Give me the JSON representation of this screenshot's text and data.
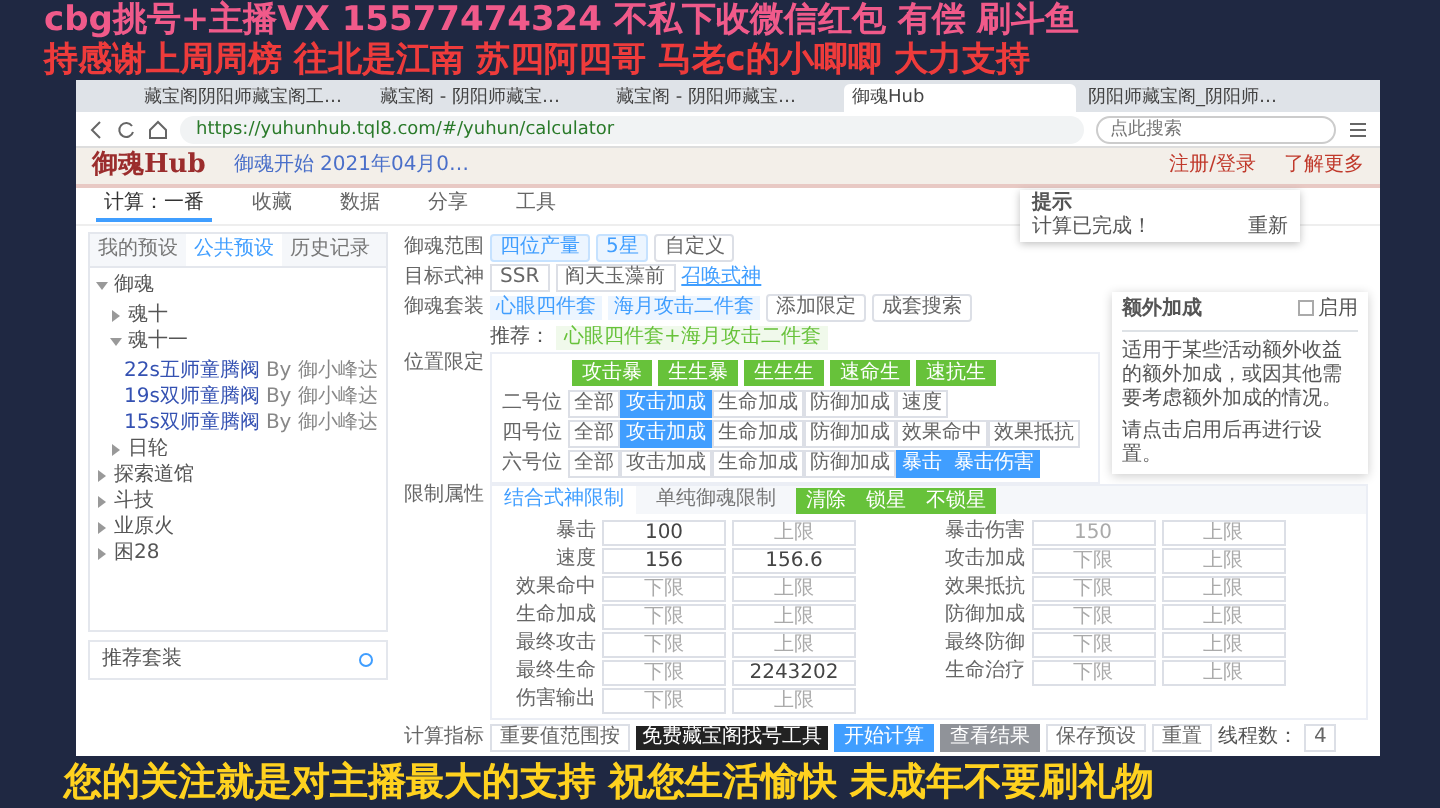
{
  "overlay": {
    "top_lines": [
      "cbg挑号+主播VX 15577474324 不私下收微信红包 有偿 刷斗鱼",
      "持感谢上周周榜  往北是江南 苏四阿四哥 马老c的小唧唧 大力支持"
    ],
    "bottom_line": "您的关注就是对主播最大的支持 祝您生活愉快 未成年不要刷礼物"
  },
  "browser": {
    "tabs": [
      {
        "title": "藏宝阁阴阳师藏宝阁工…",
        "selected": false
      },
      {
        "title": "藏宝阁 - 阴阳师藏宝…",
        "selected": false
      },
      {
        "title": "藏宝阁 - 阴阳师藏宝…",
        "selected": false
      },
      {
        "title": "御魂Hub",
        "selected": true
      },
      {
        "title": "阴阳师藏宝阁_阴阳师…",
        "selected": false
      }
    ],
    "url": "https://yuhunhub.tql8.com/#/yuhun/calculator",
    "search_placeholder": "点此搜索"
  },
  "header": {
    "logo": "御魂Hub",
    "notice": "御魂开始 2021年04月0…",
    "links": [
      "注册/登录",
      "了解更多"
    ]
  },
  "nav": [
    {
      "label": "计算：一番",
      "selected": true
    },
    {
      "label": "收藏",
      "selected": false
    },
    {
      "label": "数据",
      "selected": false
    },
    {
      "label": "分享",
      "selected": false
    },
    {
      "label": "工具",
      "selected": false
    }
  ],
  "sidebar": {
    "tabs": [
      {
        "label": "我的预设",
        "selected": false
      },
      {
        "label": "公共预设",
        "selected": true
      },
      {
        "label": "历史记录",
        "selected": false
      }
    ],
    "tree": [
      {
        "label": "御魂",
        "expanded": true,
        "children": [
          {
            "label": "魂十",
            "expanded": false
          },
          {
            "label": "魂十一",
            "expanded": true,
            "children": [
              {
                "label": "22s五师童腾阀",
                "author": "By 御小峰达"
              },
              {
                "label": "19s双师童腾阀",
                "author": "By 御小峰达"
              },
              {
                "label": "15s双师童腾阀",
                "author": "By 御小峰达"
              }
            ]
          },
          {
            "label": "日轮",
            "expanded": false
          }
        ]
      },
      {
        "label": "探索道馆",
        "expanded": false
      },
      {
        "label": "斗技",
        "expanded": false
      },
      {
        "label": "业原火",
        "expanded": false
      },
      {
        "label": "困28",
        "expanded": false
      }
    ],
    "panel_title": "推荐套装"
  },
  "form": {
    "range": {
      "label": "御魂范围",
      "options": [
        {
          "label": "四位产量",
          "selected": true
        },
        {
          "label": "5星",
          "selected": true
        },
        {
          "label": "自定义",
          "selected": false
        }
      ]
    },
    "target": {
      "label": "目标式神",
      "rarity": "SSR",
      "shikigami": "阎天玉藻前",
      "link": "召唤式神"
    },
    "set": {
      "label": "御魂套装",
      "tags": [
        "心眼四件套",
        "海月攻击二件套"
      ],
      "buttons": [
        "添加限定",
        "成套搜索"
      ],
      "hint_label": "推荐：",
      "hint": "心眼四件套+海月攻击二件套"
    },
    "position": {
      "label": "位置限定",
      "presets": [
        "攻击暴",
        "生生暴",
        "生生生",
        "速命生",
        "速抗生"
      ],
      "rows": [
        {
          "label": "二号位",
          "options": [
            {
              "label": "全部",
              "selected": false
            },
            {
              "label": "攻击加成",
              "selected": true
            },
            {
              "label": "生命加成",
              "selected": false
            },
            {
              "label": "防御加成",
              "selected": false
            },
            {
              "label": "速度",
              "selected": false
            }
          ]
        },
        {
          "label": "四号位",
          "options": [
            {
              "label": "全部",
              "selected": false
            },
            {
              "label": "攻击加成",
              "selected": true
            },
            {
              "label": "生命加成",
              "selected": false
            },
            {
              "label": "防御加成",
              "selected": false
            },
            {
              "label": "效果命中",
              "selected": false
            },
            {
              "label": "效果抵抗",
              "selected": false
            }
          ]
        },
        {
          "label": "六号位",
          "options": [
            {
              "label": "全部",
              "selected": false
            },
            {
              "label": "攻击加成",
              "selected": false
            },
            {
              "label": "生命加成",
              "selected": false
            },
            {
              "label": "防御加成",
              "selected": false
            },
            {
              "label": "暴击",
              "selected": true
            },
            {
              "label": "暴击伤害",
              "selected": true
            }
          ]
        }
      ]
    },
    "limits": {
      "label": "限制属性",
      "tabs": [
        {
          "label": "结合式神限制",
          "selected": true
        },
        {
          "label": "单纯御魂限制",
          "selected": false
        }
      ],
      "buttons": [
        "清除",
        "锁星",
        "不锁星"
      ],
      "left": [
        {
          "label": "暴击",
          "min": {
            "value": "100"
          },
          "max": {
            "placeholder": "上限"
          }
        },
        {
          "label": "速度",
          "min": {
            "value": "156"
          },
          "max": {
            "value": "156.6"
          }
        },
        {
          "label": "效果命中",
          "min": {
            "placeholder": "下限"
          },
          "max": {
            "placeholder": "上限"
          }
        },
        {
          "label": "生命加成",
          "min": {
            "placeholder": "下限"
          },
          "max": {
            "placeholder": "上限"
          }
        },
        {
          "label": "最终攻击",
          "min": {
            "placeholder": "下限"
          },
          "max": {
            "placeholder": "上限"
          }
        },
        {
          "label": "最终生命",
          "min": {
            "placeholder": "下限"
          },
          "max": {
            "value": "2243202"
          }
        },
        {
          "label": "伤害输出",
          "min": {
            "placeholder": "下限"
          },
          "max": {
            "placeholder": "上限"
          }
        }
      ],
      "right": [
        {
          "label": "暴击伤害",
          "min": {
            "placeholder": "150"
          },
          "max": {
            "placeholder": "上限"
          }
        },
        {
          "label": "攻击加成",
          "min": {
            "placeholder": "下限"
          },
          "max": {
            "placeholder": "上限"
          }
        },
        {
          "label": "效果抵抗",
          "min": {
            "placeholder": "下限"
          },
          "max": {
            "placeholder": "上限"
          }
        },
        {
          "label": "防御加成",
          "min": {
            "placeholder": "下限"
          },
          "max": {
            "placeholder": "上限"
          }
        },
        {
          "label": "最终防御",
          "min": {
            "placeholder": "下限"
          },
          "max": {
            "placeholder": "上限"
          }
        },
        {
          "label": "生命治疗",
          "min": {
            "placeholder": "下限"
          },
          "max": {
            "placeholder": "上限"
          }
        }
      ]
    },
    "footer": {
      "label": "计算指标",
      "metric": "重要值范围按",
      "badge": "免费藏宝阁找号工具",
      "start": "开始计算",
      "view": "查看结果",
      "save": "保存预设",
      "reset": "重置",
      "threads_label": "线程数：",
      "threads": "4"
    }
  },
  "toast": {
    "title": "提示",
    "text": "计算已完成！",
    "action": "重新"
  },
  "popover": {
    "title": "额外加成",
    "enable": "启用",
    "enabled": false,
    "text": "适用于某些活动额外收益的额外加成，或因其他需要考虑额外加成的情况。",
    "note": "请点击启用后再进行设置。"
  }
}
